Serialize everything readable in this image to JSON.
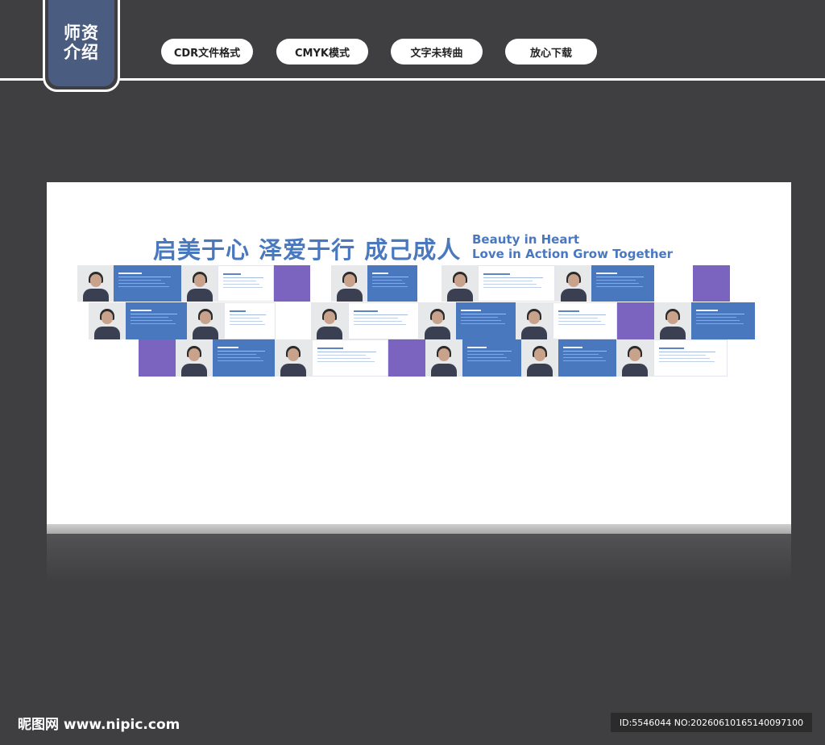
{
  "header": {
    "badge_text": "师资介绍",
    "pills": [
      "CDR文件格式",
      "CMYK模式",
      "文字未转曲",
      "放心下载"
    ]
  },
  "wall": {
    "headline_cn": "启美于心 泽爱于行 成己成人",
    "headline_en_line1": "Beauty in Heart",
    "headline_en_line2": "Love in Action  Grow Together",
    "accent_color": "#4a78bf",
    "purple_color": "#7a64c0"
  },
  "footer": {
    "logo": "昵图网 www.nipic.com",
    "id": "ID:5546044 NO:20260610165140097100"
  }
}
